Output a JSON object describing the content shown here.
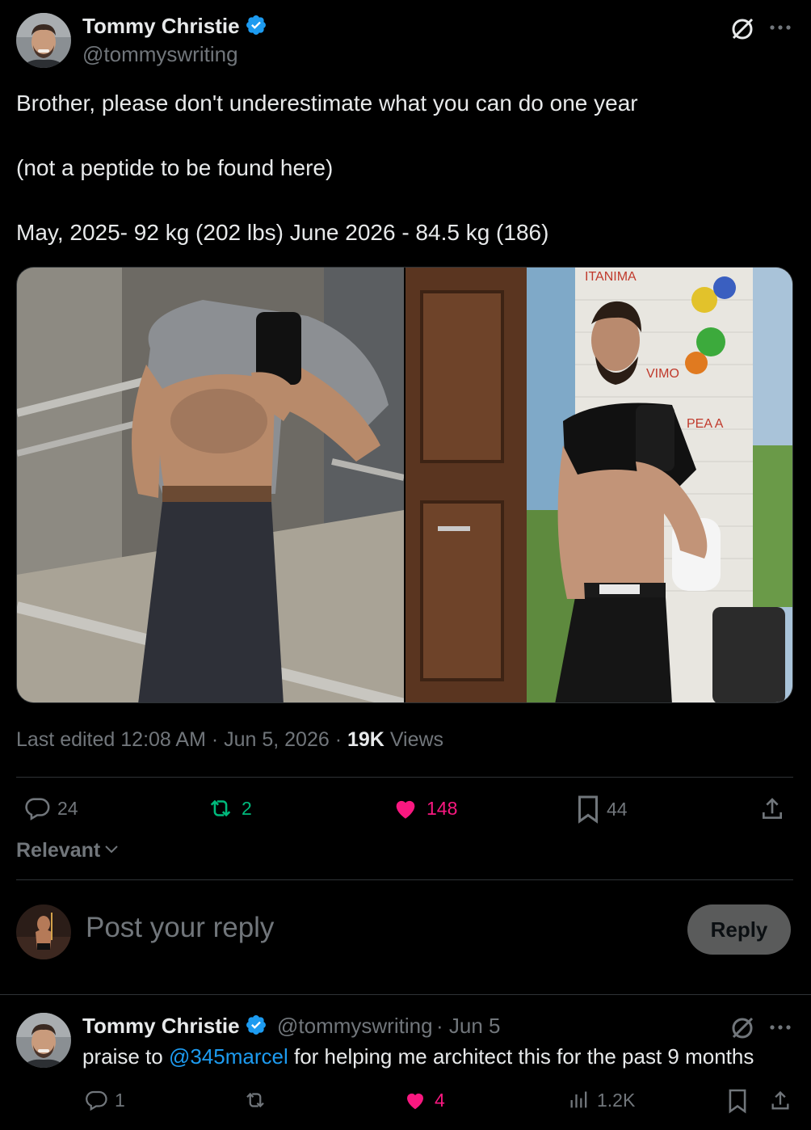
{
  "tweet": {
    "author_name": "Tommy Christie",
    "author_handle": "@tommyswriting",
    "lines": [
      "Brother, please don't underestimate what you can do one year",
      "(not a peptide to be found here)",
      "May, 2025-  92 kg  (202 lbs)  June 2026 - 84.5 kg (186)"
    ],
    "meta_edited": "Last edited 12:08 AM · Jun 5, 2026 · ",
    "views_count": "19K",
    "views_label": " Views",
    "images": {
      "overlay_text_1": "ITANIMA",
      "overlay_text_2": "VIMO",
      "overlay_text_3": "PEA A"
    },
    "actions": {
      "replies": "24",
      "reposts": "2",
      "likes": "148",
      "bookmarks": "44"
    },
    "icons": [
      "grok-icon",
      "more-icon",
      "verified-badge-icon",
      "reply-icon",
      "repost-icon",
      "heart-icon",
      "bookmark-icon",
      "share-icon"
    ]
  },
  "sort": {
    "label": "Relevant"
  },
  "composer": {
    "placeholder": "Post your reply",
    "button_label": "Reply"
  },
  "reply": {
    "author_name": "Tommy Christie",
    "author_handle": "@tommyswriting",
    "date": "· Jun 5",
    "text_before": "praise to ",
    "mention": "@345marcel",
    "text_after": " for helping me architect this for the past 9 months",
    "actions": {
      "replies": "1",
      "likes": "4",
      "views": "1.2K"
    }
  },
  "colors": {
    "background": "#000000",
    "text": "#e7e9ea",
    "muted": "#71767b",
    "accent": "#1d9bf0",
    "repost_green": "#00ba7c",
    "like_pink": "#f91880",
    "border": "#2f3336"
  }
}
